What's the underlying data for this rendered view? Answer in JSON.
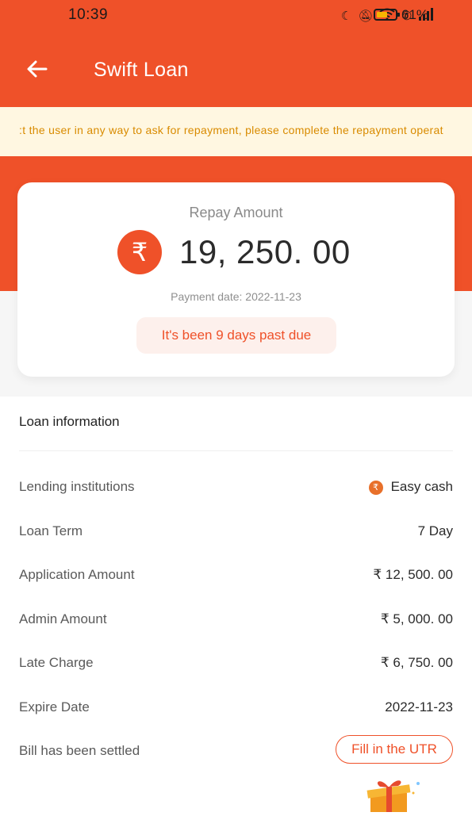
{
  "status_bar": {
    "time": "10:39",
    "battery": "61%",
    "battery_level": 0.61,
    "icons": [
      "moon-icon",
      "mute-icon",
      "wifi-icon",
      "call-icon",
      "signal-icon"
    ]
  },
  "header": {
    "title": "Swift Loan",
    "back_icon": "arrow-left-icon"
  },
  "notice": {
    "text": ":t the user in any way to ask for repayment, please complete the repayment operat"
  },
  "repay_card": {
    "label": "Repay Amount",
    "currency_symbol": "₹",
    "amount": "19, 250. 00",
    "payment_date": "Payment date: 2022-11-23",
    "overdue": "It's been 9 days past due"
  },
  "loan_info": {
    "title": "Loan information",
    "rows": [
      {
        "label": "Lending institutions",
        "value": "Easy cash",
        "logo": "₹"
      },
      {
        "label": "Loan Term",
        "value": "7 Day"
      },
      {
        "label": "Application Amount",
        "value": "₹ 12, 500. 00"
      },
      {
        "label": "Admin Amount",
        "value": "₹ 5, 000. 00"
      },
      {
        "label": "Late Charge",
        "value": "₹ 6, 750. 00"
      },
      {
        "label": "Expire Date",
        "value": "2022-11-23"
      },
      {
        "label": "Bill has been settled",
        "button": "Fill in the UTR"
      }
    ]
  },
  "colors": {
    "brand": "#ef5129",
    "notice_bg": "#fff7e1",
    "notice_text": "#d98b00"
  }
}
